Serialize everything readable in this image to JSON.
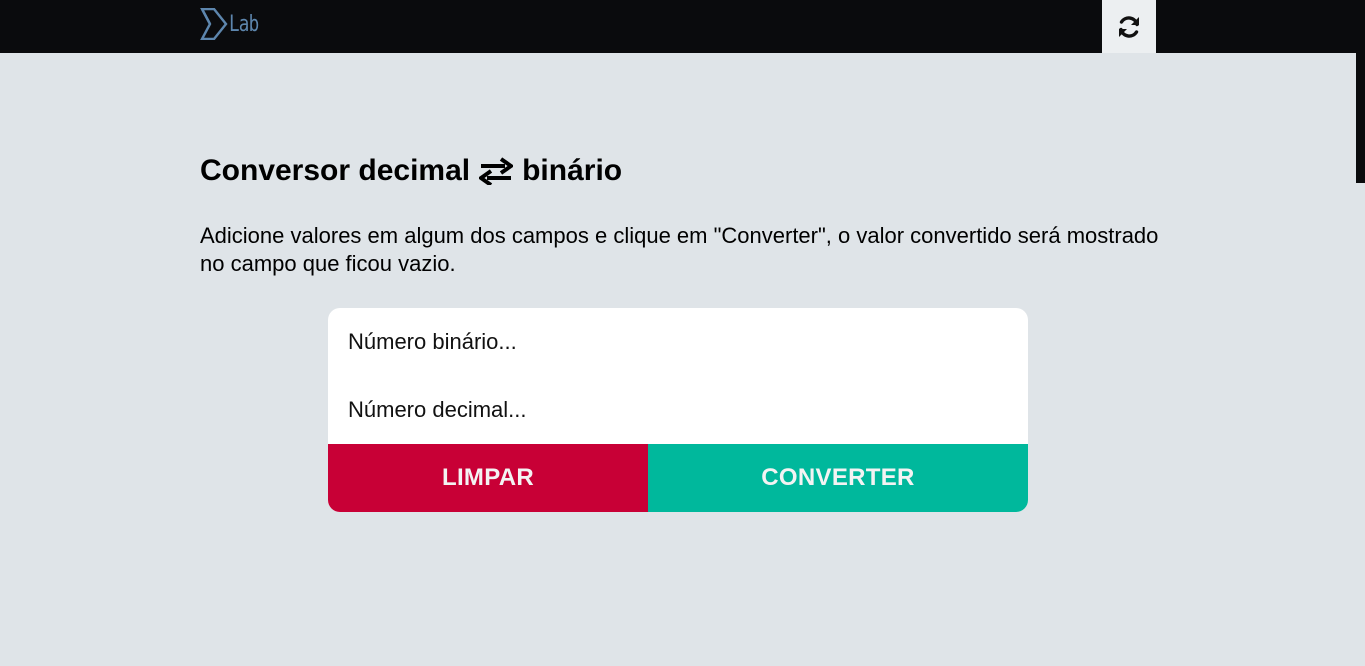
{
  "header": {
    "logo_text": "Lab",
    "refresh_icon": "refresh-icon",
    "colors": {
      "background": "#0a0b0d",
      "logo": "#5d86ad",
      "refresh_bg": "#eceff1"
    }
  },
  "main": {
    "title_left": "Conversor decimal",
    "title_icon": "swap-arrows-icon",
    "title_right": "binário",
    "description": "Adicione valores em algum dos campos e clique em \"Converter\", o valor convertido será mostrado no campo que ficou vazio."
  },
  "form": {
    "binary_input": {
      "value": "",
      "placeholder": "Número binário..."
    },
    "decimal_input": {
      "value": "",
      "placeholder": "Número decimal..."
    },
    "clear_label": "LIMPAR",
    "convert_label": "CONVERTER",
    "colors": {
      "clear": "#c80036",
      "convert": "#00b89c",
      "page_bg": "#dfe4e8"
    }
  }
}
